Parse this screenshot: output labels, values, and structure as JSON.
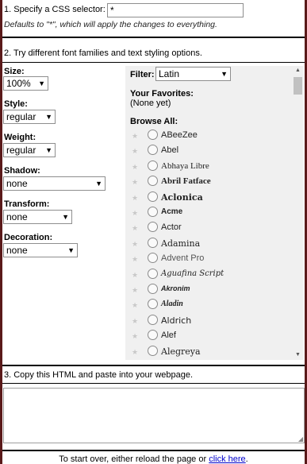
{
  "step1": {
    "label": "1. Specify a CSS selector:",
    "selector_value": "*",
    "hint": "Defaults to \"*\", which will apply the changes to everything."
  },
  "step2": {
    "label": "2. Try different font families and text styling options.",
    "controls": {
      "size": {
        "label": "Size:",
        "value": "100%"
      },
      "style": {
        "label": "Style:",
        "value": "regular"
      },
      "weight": {
        "label": "Weight:",
        "value": "regular"
      },
      "shadow": {
        "label": "Shadow:",
        "value": "none"
      },
      "transform": {
        "label": "Transform:",
        "value": "none"
      },
      "decoration": {
        "label": "Decoration:",
        "value": "none"
      }
    },
    "filter": {
      "label": "Filter:",
      "value": "Latin"
    },
    "favorites": {
      "label": "Your Favorites:",
      "empty_text": "(None yet)"
    },
    "browse": {
      "label": "Browse All:",
      "fonts": [
        "ABeeZee",
        "Abel",
        "Abhaya Libre",
        "Abril Fatface",
        "Aclonica",
        "Acme",
        "Actor",
        "Adamina",
        "Advent Pro",
        "Aguafina Script",
        "Akronim",
        "Aladin",
        "Aldrich",
        "Alef",
        "Alegreya"
      ]
    }
  },
  "step3": {
    "label": "3. Copy this HTML and paste into your webpage.",
    "html_value": ""
  },
  "footer": {
    "text": "To start over, either reload the page or",
    "link_text": "click here",
    "end": "."
  },
  "icons": {
    "select_arrow": "caret-down-icon",
    "favorite": "star-icon",
    "scroll_up": "scroll-up-icon",
    "scroll_down": "scroll-down-icon",
    "resize": "resize-grip-icon"
  }
}
